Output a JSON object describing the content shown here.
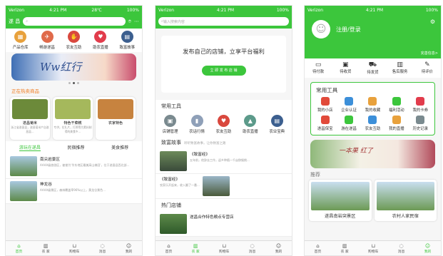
{
  "status": {
    "carrier": "Verizon",
    "time": "4:21 PM",
    "temp": "28℃",
    "battery": "100%"
  },
  "p1": {
    "city": "遂 昌",
    "search_placeholder": "",
    "quick": [
      {
        "label": "产品仓库",
        "color": "#e8a13c",
        "icon": "warehouse-icon"
      },
      {
        "label": "畅游遂昌",
        "color": "#e06a4a",
        "icon": "travel-icon"
      },
      {
        "label": "农友互助",
        "color": "#d9483e",
        "icon": "handshake-icon"
      },
      {
        "label": "助农直播",
        "color": "#e23c4c",
        "icon": "heart-icon"
      },
      {
        "label": "致富故事",
        "color": "#3c5f8f",
        "icon": "book-icon"
      }
    ],
    "banner_text": "Ww红行",
    "hot_title": "正在热卖商品",
    "cards": [
      {
        "name": "遂昌菊米",
        "desc": "浙江省遂昌县，遂昌菊米产自遂昌县...",
        "color": "#6c8a3a"
      },
      {
        "name": "特色干菜糕",
        "desc": "专供，拉扎片，打蹄等为素料制得的美食乡...",
        "color": "#a5b85c"
      },
      {
        "name": "农家特色",
        "desc": "",
        "color": "#c7833f"
      }
    ],
    "tabs": [
      "游玩在遂昌",
      "民宿推荐",
      "美食推荐"
    ],
    "news": [
      {
        "title": "南尖岩景区",
        "desc": "AAAA级旅游区，被誉为'华东地区最美高山梯田'，位于遂昌县西北部..."
      },
      {
        "title": "神龙谷",
        "desc": "AAAA级景区，森林覆盖率96%以上，黄龙谷景色..."
      }
    ]
  },
  "p2": {
    "search_placeholder": "输入搜索内容",
    "promo_title": "发布自己的店铺，立享平台福利",
    "promo_btn": "立 即 发 布 店 铺",
    "tools_title": "常用工具",
    "tools": [
      {
        "label": "店铺管理",
        "color": "#7a8a8f"
      },
      {
        "label": "农话行情",
        "color": "#8fa0b8"
      },
      {
        "label": "农友互助",
        "color": "#d9483e"
      },
      {
        "label": "助农直播",
        "color": "#5c9a8a"
      },
      {
        "label": "农业宝典",
        "color": "#3c5f8f"
      }
    ],
    "story_title": "致富故事",
    "story_sub": "听听致富故事，让你致富之路",
    "stories": [
      {
        "title": "《致富经》",
        "desc": "五年前，他辞去工作，返乡种植一千亩猕猴桃..."
      },
      {
        "title": "《致富经》",
        "desc": "农家乐开起来，收入翻了一番..."
      }
    ],
    "shop_title": "热门店铺",
    "shop_name": "遂昌合作特色粮点专营店"
  },
  "p3": {
    "login_label": "注册/登录",
    "complete_label": "完善信息>",
    "orders": [
      "待付款",
      "待收货",
      "待发货",
      "售后服务",
      "待评价"
    ],
    "tools_title": "常用工具",
    "grid": [
      [
        {
          "label": "我的小店",
          "color": "#e14a3a"
        },
        {
          "label": "企业认证",
          "color": "#3c8fd9"
        },
        {
          "label": "我的收藏",
          "color": "#e8a13c"
        },
        {
          "label": "福利活动",
          "color": "#3cc63c"
        },
        {
          "label": "我的卡券",
          "color": "#e23c4c"
        }
      ],
      [
        {
          "label": "遂昌保宝",
          "color": "#e14a3a"
        },
        {
          "label": "游在遂昌",
          "color": "#3cc63c"
        },
        {
          "label": "农友互助",
          "color": "#3c8fd9"
        },
        {
          "label": "我的直播",
          "color": "#e8a13c"
        },
        {
          "label": "历史记录",
          "color": "#7a8a8f"
        }
      ]
    ],
    "banner_text": "一本果 红了",
    "rec_title": "推荐",
    "recs": [
      "遂昌南岩突景区",
      "农村人家民宿"
    ]
  },
  "tabbar": {
    "items": [
      "首页",
      "农 家",
      "购物车",
      "消息",
      "我的"
    ]
  }
}
